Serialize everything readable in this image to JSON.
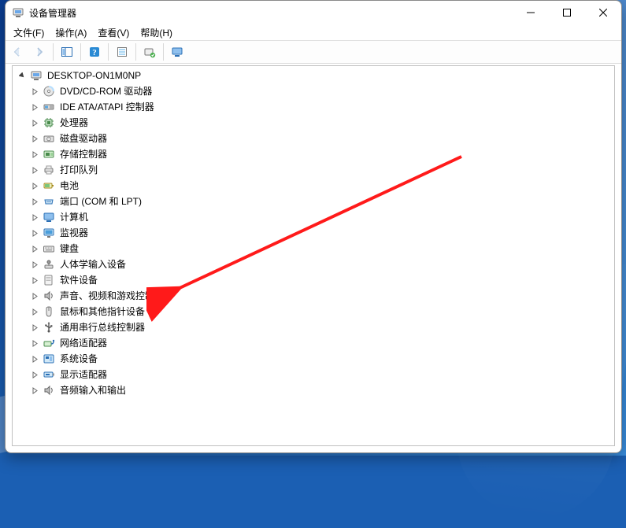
{
  "window": {
    "title": "设备管理器"
  },
  "menu": {
    "file": "文件(F)",
    "action": "操作(A)",
    "view": "查看(V)",
    "help": "帮助(H)"
  },
  "tree": {
    "root": "DESKTOP-ON1M0NP",
    "categories": [
      "DVD/CD-ROM 驱动器",
      "IDE ATA/ATAPI 控制器",
      "处理器",
      "磁盘驱动器",
      "存储控制器",
      "打印队列",
      "电池",
      "端口 (COM 和 LPT)",
      "计算机",
      "监视器",
      "键盘",
      "人体学输入设备",
      "软件设备",
      "声音、视频和游戏控制器",
      "鼠标和其他指针设备",
      "通用串行总线控制器",
      "网络适配器",
      "系统设备",
      "显示适配器",
      "音频输入和输出"
    ]
  },
  "annotation": {
    "target_category_index": 13
  }
}
